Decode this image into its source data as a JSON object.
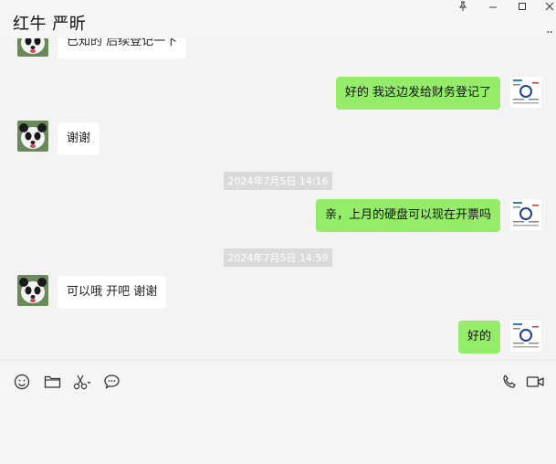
{
  "window": {
    "title": "红牛 严昕",
    "controls": [
      "pin-icon",
      "minimize-icon",
      "maximize-icon",
      "close-icon"
    ],
    "more_label": "··"
  },
  "messages": [
    {
      "side": "in",
      "text": "已知的 后续登记一下"
    },
    {
      "side": "out",
      "text": "好的 我这边发给财务登记了"
    },
    {
      "side": "in",
      "text": "谢谢"
    },
    {
      "type": "time",
      "text": "2024年7月5日 14:16"
    },
    {
      "side": "out",
      "text": "亲，上月的硬盘可以现在开票吗"
    },
    {
      "type": "time",
      "text": "2024年7月5日 14:59"
    },
    {
      "side": "in",
      "text": "可以哦 开吧 谢谢"
    },
    {
      "side": "out",
      "text": "好的"
    }
  ],
  "toolbar": {
    "left_icons": [
      "emoji-icon",
      "folder-icon",
      "scissors-icon",
      "chat-bubble-icon"
    ],
    "right_icons": [
      "phone-icon",
      "video-icon"
    ]
  },
  "colors": {
    "outgoing_bubble": "#95ec69",
    "incoming_bubble": "#ffffff",
    "background": "#f3f3f3"
  }
}
